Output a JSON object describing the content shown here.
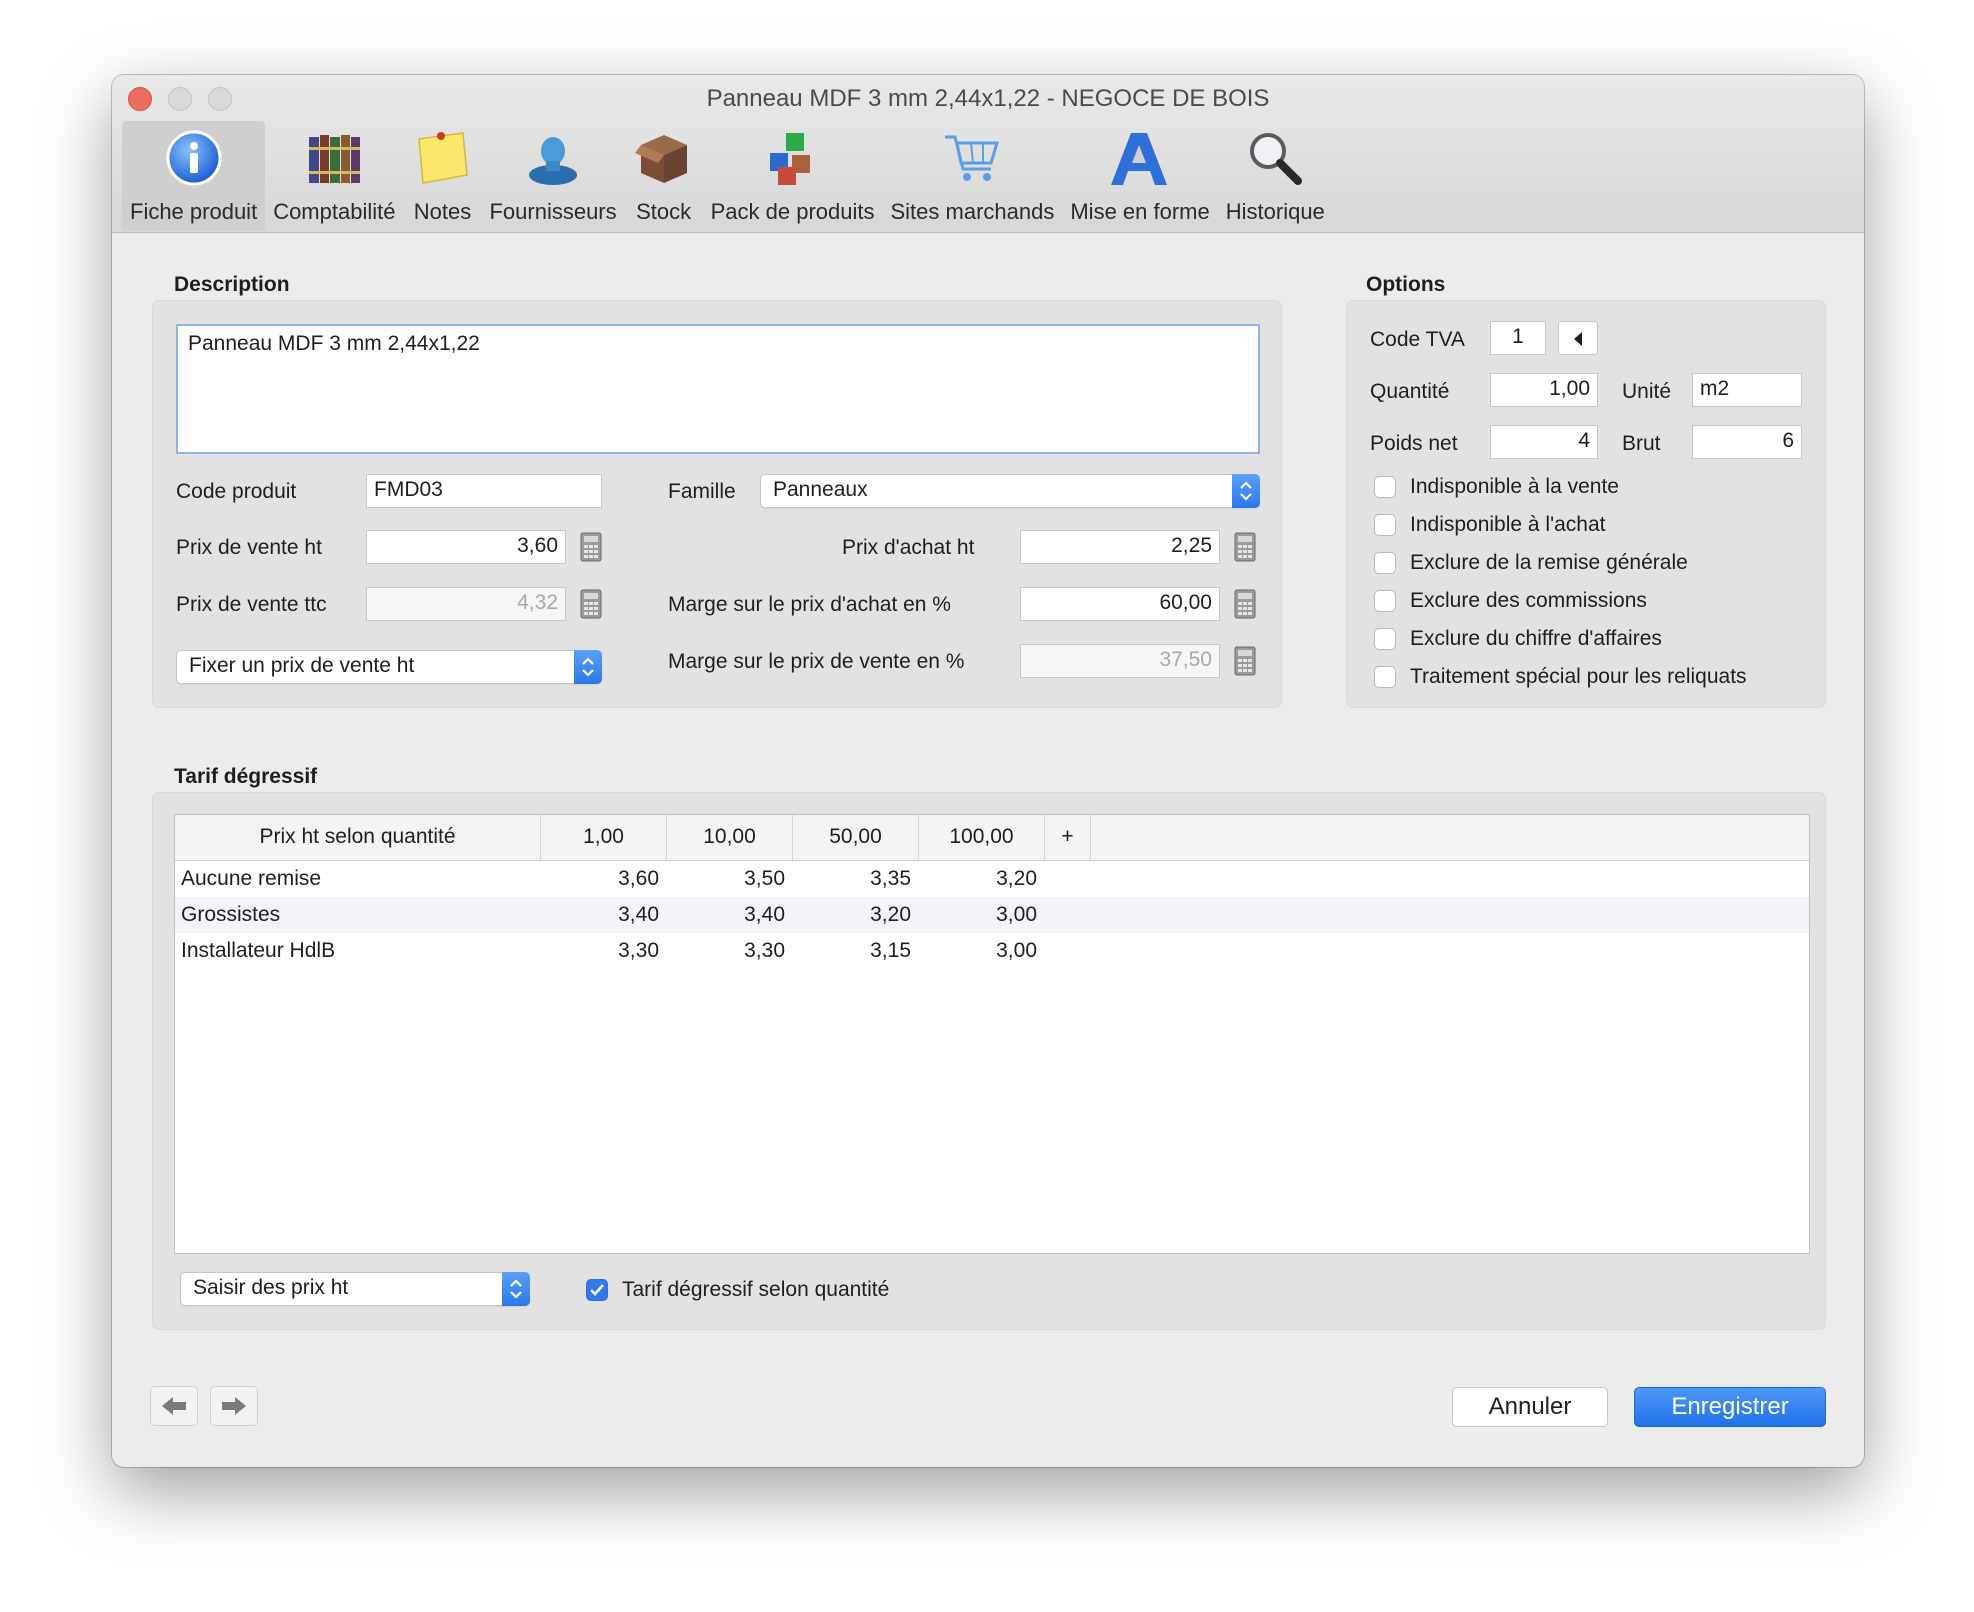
{
  "window": {
    "title": "Panneau MDF 3 mm 2,44x1,22 - NEGOCE DE BOIS"
  },
  "toolbar": {
    "items": [
      {
        "label": "Fiche produit",
        "icon": "info-icon"
      },
      {
        "label": "Comptabilité",
        "icon": "books-icon"
      },
      {
        "label": "Notes",
        "icon": "sticky-note-icon"
      },
      {
        "label": "Fournisseurs",
        "icon": "person-icon"
      },
      {
        "label": "Stock",
        "icon": "box-icon"
      },
      {
        "label": "Pack de produits",
        "icon": "cubes-icon"
      },
      {
        "label": "Sites marchands",
        "icon": "cart-icon"
      },
      {
        "label": "Mise en forme",
        "icon": "letter-a-icon"
      },
      {
        "label": "Historique",
        "icon": "magnifier-icon"
      }
    ],
    "active_index": 0
  },
  "description": {
    "section_title": "Description",
    "text": "Panneau MDF 3 mm 2,44x1,22",
    "code_produit_label": "Code produit",
    "code_produit": "FMD03",
    "famille_label": "Famille",
    "famille": "Panneaux",
    "prix_vente_ht_label": "Prix de vente ht",
    "prix_vente_ht": "3,60",
    "prix_vente_ttc_label": "Prix de vente ttc",
    "prix_vente_ttc": "4,32",
    "prix_achat_ht_label": "Prix d'achat ht",
    "prix_achat_ht": "2,25",
    "marge_achat_label": "Marge sur le prix d'achat en %",
    "marge_achat": "60,00",
    "marge_vente_label": "Marge sur le prix de vente en %",
    "marge_vente": "37,50",
    "price_mode": "Fixer un prix de vente ht"
  },
  "options": {
    "section_title": "Options",
    "code_tva_label": "Code TVA",
    "code_tva": "1",
    "quantite_label": "Quantité",
    "quantite": "1,00",
    "unite_label": "Unité",
    "unite": "m2",
    "poids_net_label": "Poids net",
    "poids_net": "4",
    "brut_label": "Brut",
    "brut": "6",
    "checkboxes": [
      {
        "label": "Indisponible à la vente",
        "checked": false
      },
      {
        "label": "Indisponible à l'achat",
        "checked": false
      },
      {
        "label": "Exclure de la remise générale",
        "checked": false
      },
      {
        "label": "Exclure des commissions",
        "checked": false
      },
      {
        "label": "Exclure du chiffre d'affaires",
        "checked": false
      },
      {
        "label": "Traitement spécial pour les reliquats",
        "checked": false
      }
    ]
  },
  "tarif": {
    "section_title": "Tarif dégressif",
    "columns": [
      "Prix ht selon quantité",
      "1,00",
      "10,00",
      "50,00",
      "100,00",
      "+"
    ],
    "rows": [
      {
        "name": "Aucune remise",
        "values": [
          "3,60",
          "3,50",
          "3,35",
          "3,20"
        ]
      },
      {
        "name": "Grossistes",
        "values": [
          "3,40",
          "3,40",
          "3,20",
          "3,00"
        ]
      },
      {
        "name": "Installateur HdlB",
        "values": [
          "3,30",
          "3,30",
          "3,15",
          "3,00"
        ]
      }
    ],
    "price_entry_mode": "Saisir des prix ht",
    "degressive_checkbox_label": "Tarif dégressif selon quantité",
    "degressive_checked": true
  },
  "footer": {
    "cancel_label": "Annuler",
    "save_label": "Enregistrer"
  },
  "colors": {
    "accent": "#2f7bec",
    "close_button": "#ed6b5f",
    "window_bg": "#ececec"
  }
}
